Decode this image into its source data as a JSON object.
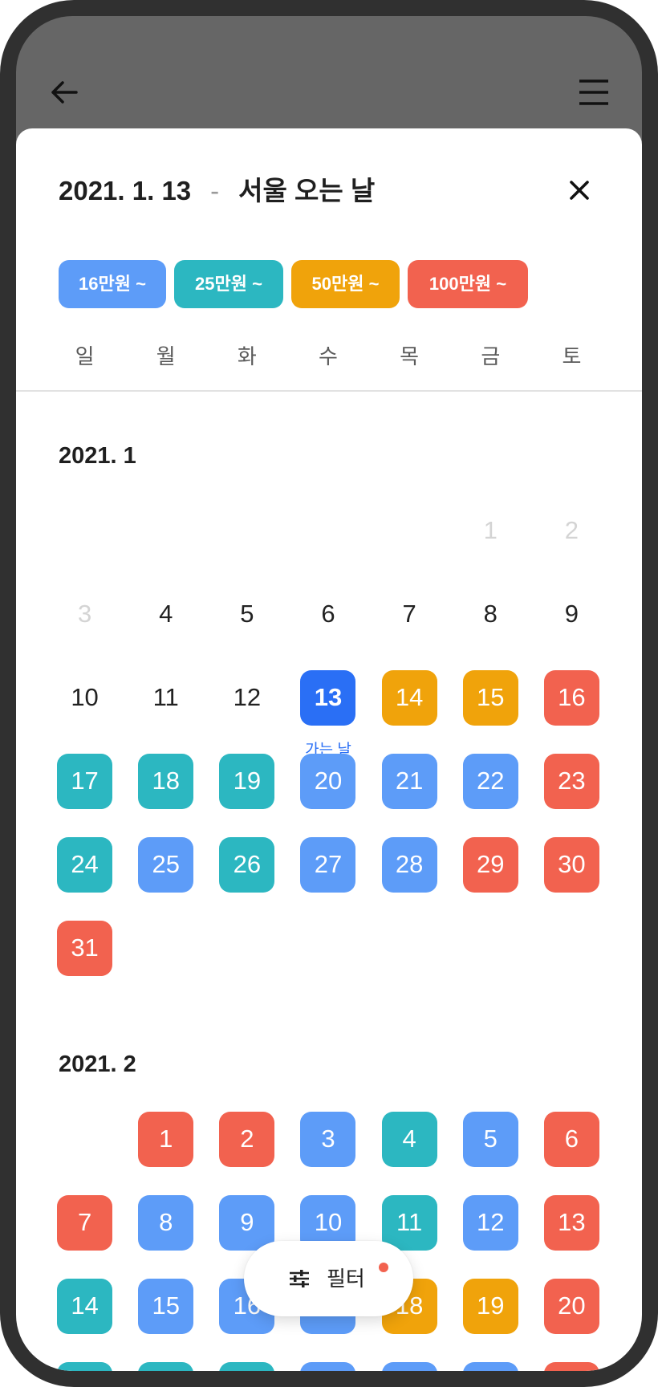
{
  "header": {
    "back_icon": "back-arrow-icon",
    "menu_icon": "hamburger-menu-icon"
  },
  "sheet": {
    "title": {
      "date": "2021. 1. 13",
      "separator": "-",
      "label": "서울 오는 날"
    },
    "close_icon": "close-icon",
    "price_filters": [
      {
        "label": "16만원 ~",
        "tier": "t16"
      },
      {
        "label": "25만원 ~",
        "tier": "t25"
      },
      {
        "label": "50만원 ~",
        "tier": "t50"
      },
      {
        "label": "100만원 ~",
        "tier": "t100"
      }
    ],
    "weekdays": [
      "일",
      "월",
      "화",
      "수",
      "목",
      "금",
      "토"
    ],
    "months": [
      {
        "title": "2021. 1",
        "weeks": [
          [
            null,
            null,
            null,
            null,
            null,
            {
              "day": "1",
              "kind": "disabled"
            },
            {
              "day": "2",
              "kind": "disabled"
            }
          ],
          [
            {
              "day": "3",
              "kind": "disabled"
            },
            {
              "day": "4",
              "kind": "plain"
            },
            {
              "day": "5",
              "kind": "plain"
            },
            {
              "day": "6",
              "kind": "plain"
            },
            {
              "day": "7",
              "kind": "plain"
            },
            {
              "day": "8",
              "kind": "plain"
            },
            {
              "day": "9",
              "kind": "plain"
            }
          ],
          [
            {
              "day": "10",
              "kind": "plain"
            },
            {
              "day": "11",
              "kind": "plain"
            },
            {
              "day": "12",
              "kind": "plain"
            },
            {
              "day": "13",
              "kind": "selected",
              "note": "가는 날"
            },
            {
              "day": "14",
              "kind": "t50"
            },
            {
              "day": "15",
              "kind": "t50"
            },
            {
              "day": "16",
              "kind": "t100"
            }
          ],
          [
            {
              "day": "17",
              "kind": "t25"
            },
            {
              "day": "18",
              "kind": "t25"
            },
            {
              "day": "19",
              "kind": "t25"
            },
            {
              "day": "20",
              "kind": "t16"
            },
            {
              "day": "21",
              "kind": "t16"
            },
            {
              "day": "22",
              "kind": "t16"
            },
            {
              "day": "23",
              "kind": "t100"
            }
          ],
          [
            {
              "day": "24",
              "kind": "t25"
            },
            {
              "day": "25",
              "kind": "t16"
            },
            {
              "day": "26",
              "kind": "t25"
            },
            {
              "day": "27",
              "kind": "t16"
            },
            {
              "day": "28",
              "kind": "t16"
            },
            {
              "day": "29",
              "kind": "t100"
            },
            {
              "day": "30",
              "kind": "t100"
            }
          ],
          [
            {
              "day": "31",
              "kind": "t100"
            },
            null,
            null,
            null,
            null,
            null,
            null
          ]
        ]
      },
      {
        "title": "2021. 2",
        "weeks": [
          [
            null,
            {
              "day": "1",
              "kind": "t100"
            },
            {
              "day": "2",
              "kind": "t100"
            },
            {
              "day": "3",
              "kind": "t16"
            },
            {
              "day": "4",
              "kind": "t25"
            },
            {
              "day": "5",
              "kind": "t16"
            },
            {
              "day": "6",
              "kind": "t100"
            }
          ],
          [
            {
              "day": "7",
              "kind": "t100"
            },
            {
              "day": "8",
              "kind": "t16"
            },
            {
              "day": "9",
              "kind": "t16"
            },
            {
              "day": "10",
              "kind": "t16"
            },
            {
              "day": "11",
              "kind": "t25"
            },
            {
              "day": "12",
              "kind": "t16"
            },
            {
              "day": "13",
              "kind": "t100"
            }
          ],
          [
            {
              "day": "14",
              "kind": "t25"
            },
            {
              "day": "15",
              "kind": "t16"
            },
            {
              "day": "16",
              "kind": "t16"
            },
            {
              "kind": "t16"
            },
            {
              "day": "18",
              "kind": "t50"
            },
            {
              "day": "19",
              "kind": "t50"
            },
            {
              "day": "20",
              "kind": "t100"
            }
          ],
          [
            {
              "kind": "t25"
            },
            {
              "kind": "t25"
            },
            {
              "kind": "t25"
            },
            {
              "kind": "t16"
            },
            {
              "kind": "t16"
            },
            {
              "kind": "t16"
            },
            {
              "kind": "t100"
            }
          ]
        ]
      }
    ]
  },
  "filter_button": {
    "label": "필터",
    "icon": "sliders-icon",
    "has_badge": true
  },
  "colors": {
    "t16": "#5d9cf8",
    "t25": "#2cb7c1",
    "t50": "#f0a30b",
    "t100": "#f2624f",
    "selected": "#2a6ff5",
    "note_text": "#2a6ff5",
    "badge": "#f2624f",
    "frame": "#303030",
    "header_dim": "#666666"
  }
}
